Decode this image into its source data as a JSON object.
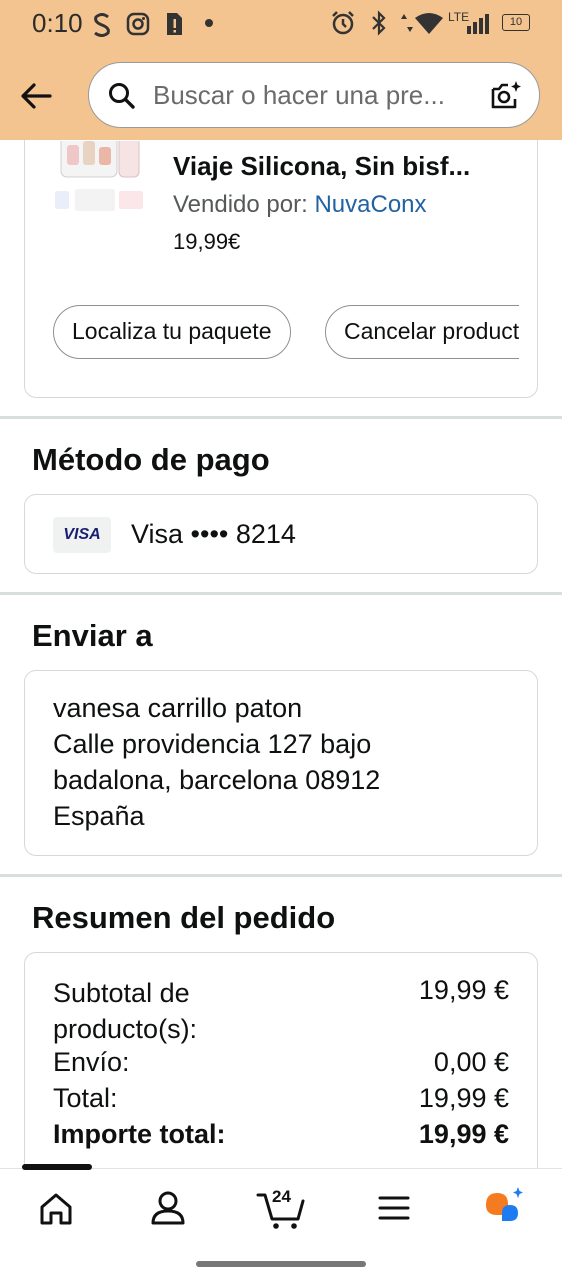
{
  "status_bar": {
    "time": "0:10",
    "battery": "10"
  },
  "search": {
    "placeholder": "Buscar o hacer una pre..."
  },
  "order_item": {
    "title": "Viaje Silicona, Sin bisf...",
    "sold_by_label": "Vendido por: ",
    "seller": "NuvaConx",
    "price": "19,99€",
    "actions": [
      "Localiza tu paquete",
      "Cancelar producto"
    ]
  },
  "payment": {
    "title": "Método de pago",
    "card_brand": "VISA",
    "card_text": "Visa •••• 8214"
  },
  "shipping": {
    "title": "Enviar a",
    "lines": [
      "vanesa carrillo paton",
      "Calle providencia 127 bajo",
      "badalona, barcelona 08912",
      "España"
    ]
  },
  "summary": {
    "title": "Resumen del pedido",
    "rows": [
      {
        "label": "Subtotal de producto(s):",
        "value": "19,99 €"
      },
      {
        "label": "Envío:",
        "value": "0,00 €"
      },
      {
        "label": "Total:",
        "value": "19,99 €"
      },
      {
        "label": "Importe total:",
        "value": "19,99 €"
      }
    ]
  },
  "bottom_nav": {
    "cart_count": "24",
    "items": [
      "home-icon",
      "account-icon",
      "cart-icon",
      "menu-icon",
      "rufus-icon"
    ]
  },
  "colors": {
    "header": "#f3c48f",
    "link": "#2162a1",
    "rufus_orange": "#f47b20",
    "rufus_blue": "#1d7cf2"
  }
}
